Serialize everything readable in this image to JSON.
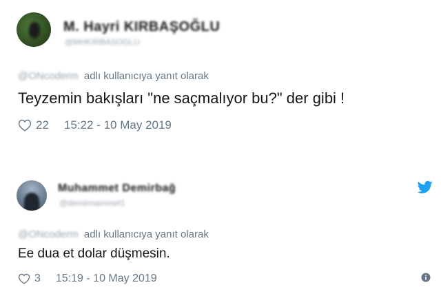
{
  "tweets": [
    {
      "display_name": "M. Hayri KIRBAŞOĞLU",
      "handle": "@MHKIRBASOGLU",
      "reply_user": "@ONcoderm",
      "reply_suffix": "adlı kullanıcıya yanıt olarak",
      "text": "Teyzemin bakışları \"ne saçmalıyor bu?\" der gibi !",
      "likes": "22",
      "timestamp": "15:22 - 10 May 2019"
    },
    {
      "display_name": "Muhammet Demirbağ",
      "handle": "@demirmammet1",
      "reply_user": "@ONcoderm",
      "reply_suffix": "adlı kullanıcıya yanıt olarak",
      "text": "Ee dua et dolar düşmesin.",
      "likes": "3",
      "timestamp": "15:19 - 10 May 2019"
    }
  ],
  "icons": {
    "like": "heart-outline-icon",
    "brand": "twitter-bird-icon",
    "info": "info-circle-icon"
  },
  "colors": {
    "text": "#14171a",
    "muted": "#657786",
    "twitter_blue": "#1da1f2"
  }
}
